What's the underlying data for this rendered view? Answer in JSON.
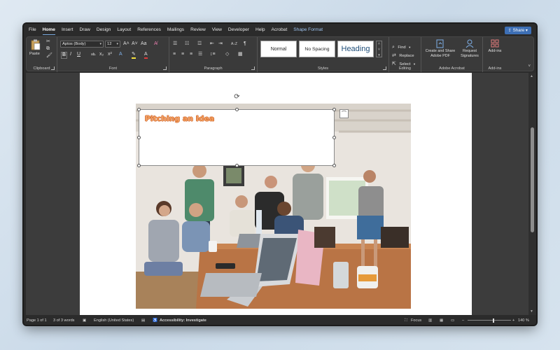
{
  "menu": {
    "tabs": [
      "File",
      "Home",
      "Insert",
      "Draw",
      "Design",
      "Layout",
      "References",
      "Mailings",
      "Review",
      "View",
      "Developer",
      "Help",
      "Acrobat",
      "Shape Format"
    ],
    "active": "Home",
    "share": "Share"
  },
  "ribbon": {
    "clipboard": {
      "label": "Clipboard",
      "paste": "Paste"
    },
    "font": {
      "label": "Font",
      "family": "Aptos (Body)",
      "size": "12"
    },
    "paragraph": {
      "label": "Paragraph"
    },
    "styles": {
      "label": "Styles",
      "items": [
        "Normal",
        "No Spacing",
        "Heading"
      ]
    },
    "editing": {
      "label": "Editing",
      "find": "Find",
      "replace": "Replace",
      "select": "Select"
    },
    "acrobat": {
      "label": "Adobe Acrobat",
      "create_pdf": "Create and Share Adobe PDF",
      "request_sig": "Request Signatures"
    },
    "addins": {
      "label": "Add-ins",
      "addins_btn": "Add-ins"
    }
  },
  "document": {
    "textbox_title": "Pitching an Idea"
  },
  "status": {
    "page": "Page 1 of 1",
    "words": "3 of 3 words",
    "language": "English (United States)",
    "accessibility": "Accessibility: Investigate",
    "focus": "Focus",
    "zoom": "140 %"
  }
}
